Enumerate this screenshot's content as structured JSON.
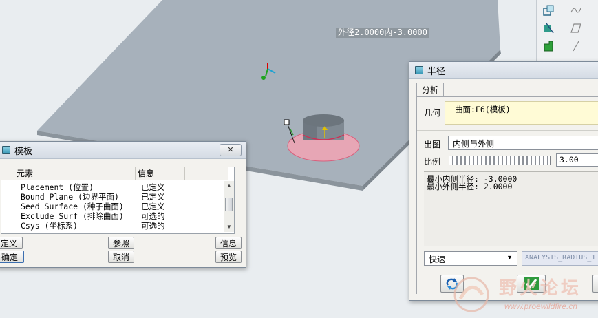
{
  "viewport": {
    "dimension_tag": "外径2.0000内-3.0000"
  },
  "template_dialog": {
    "title": "模板",
    "close_label": "✕",
    "columns": [
      "元素",
      "信息"
    ],
    "rows": [
      {
        "element": "Placement (位置)",
        "info": "已定义"
      },
      {
        "element": "Bound Plane (边界平面)",
        "info": "已定义"
      },
      {
        "element": "Seed Surface (种子曲面)",
        "info": "已定义"
      },
      {
        "element": "Exclude Surf (排除曲面)",
        "info": "可选的"
      },
      {
        "element": "Csys (坐标系)",
        "info": "可选的"
      }
    ],
    "buttons": {
      "define": "定义",
      "refs": "参照",
      "info": "信息",
      "ok": "确定",
      "cancel": "取消",
      "preview": "预览"
    }
  },
  "radius_dialog": {
    "title": "半径",
    "tab": "分析",
    "geometry_label": "几何",
    "geometry_value": "曲面:F6(模板)",
    "display_label": "出图",
    "display_value": "内侧与外侧",
    "scale_label": "比例",
    "scale_value": "3.00",
    "results": [
      "最小内侧半径: -3.0000",
      "最小外侧半径: 2.0000"
    ],
    "mode_value": "快速",
    "analysis_name": "ANALYSIS_RADIUS_1"
  },
  "watermark": {
    "text_cn": "野火论坛",
    "url": "www.proewildfire.cn"
  },
  "colors": {
    "plate": "#a7b1bb",
    "window_bg": "#f3f2ee",
    "geometry_field": "#fffbd6",
    "pink_region": "#e78fa4"
  }
}
